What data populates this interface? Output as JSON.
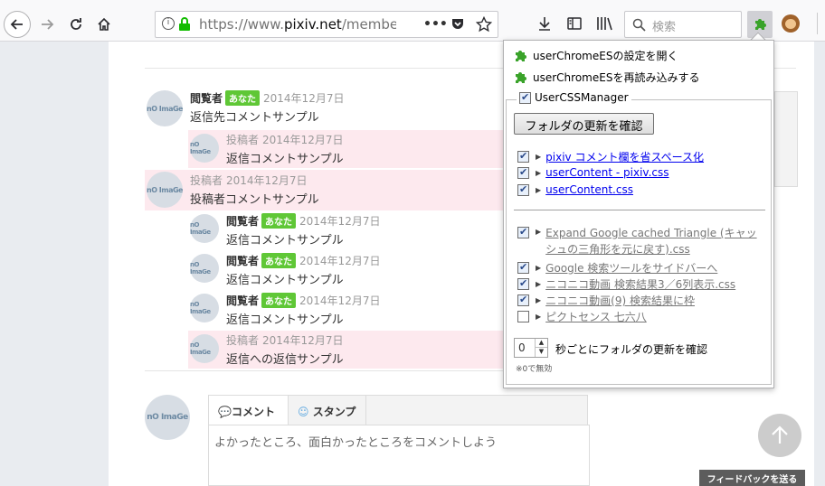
{
  "browser": {
    "url_prefix": "https://www.",
    "url_domain": "pixiv.net",
    "url_rest": "/member_",
    "page_actions": "•••",
    "search_placeholder": "検索"
  },
  "comments": [
    {
      "name": "閲覧者",
      "badge": "あなた",
      "date": "2014年12月7日",
      "text": "返信先コメントサンプル"
    },
    {
      "name": "投稿者",
      "badge": "",
      "date": "2014年12月7日",
      "text": "返信コメントサンプル"
    },
    {
      "name": "投稿者",
      "badge": "",
      "date": "2014年12月7日",
      "text": "投稿者コメントサンプル"
    },
    {
      "name": "閲覧者",
      "badge": "あなた",
      "date": "2014年12月7日",
      "text": "返信コメントサンプル"
    },
    {
      "name": "閲覧者",
      "badge": "あなた",
      "date": "2014年12月7日",
      "text": "返信コメントサンプル"
    },
    {
      "name": "閲覧者",
      "badge": "あなた",
      "date": "2014年12月7日",
      "text": "返信コメントサンプル"
    },
    {
      "name": "投稿者",
      "badge": "",
      "date": "2014年12月7日",
      "text": "返信への返信サンプル"
    }
  ],
  "avatar_text": "nO ImaGe",
  "composer": {
    "tab_comment": "コメント",
    "tab_stamp": "スタンプ",
    "placeholder": "よかったところ、面白かったところをコメントしよう"
  },
  "feedback_label": "フィードバックを送る",
  "panel": {
    "menu": [
      "userChromeESの設定を開く",
      "userChromeESを再読み込みする"
    ],
    "group_title": "UserCSSManager",
    "refresh_button": "フォルダの更新を確認",
    "styles_main": [
      {
        "label": "pixiv コメント欄を省スペース化",
        "checked": true
      },
      {
        "label": "userContent - pixiv.css",
        "checked": true
      },
      {
        "label": "userContent.css",
        "checked": true
      }
    ],
    "styles_other": [
      {
        "label": "Expand Google cached Triangle (キャッ",
        "label2": "シュの三角形を元に戻す).css",
        "checked": true
      },
      {
        "label": "Google 検索ツールをサイドバーへ",
        "checked": true
      },
      {
        "label": "ニコニコ動画 検索結果3／6列表示.css",
        "checked": true
      },
      {
        "label": "ニコニコ動画(9) 検索結果に枠",
        "checked": true
      },
      {
        "label": "ピクトセンス 七六八",
        "checked": false
      }
    ],
    "interval_value": "0",
    "interval_label": "秒ごとにフォルダの更新を確認",
    "interval_note": "※0で無効"
  }
}
